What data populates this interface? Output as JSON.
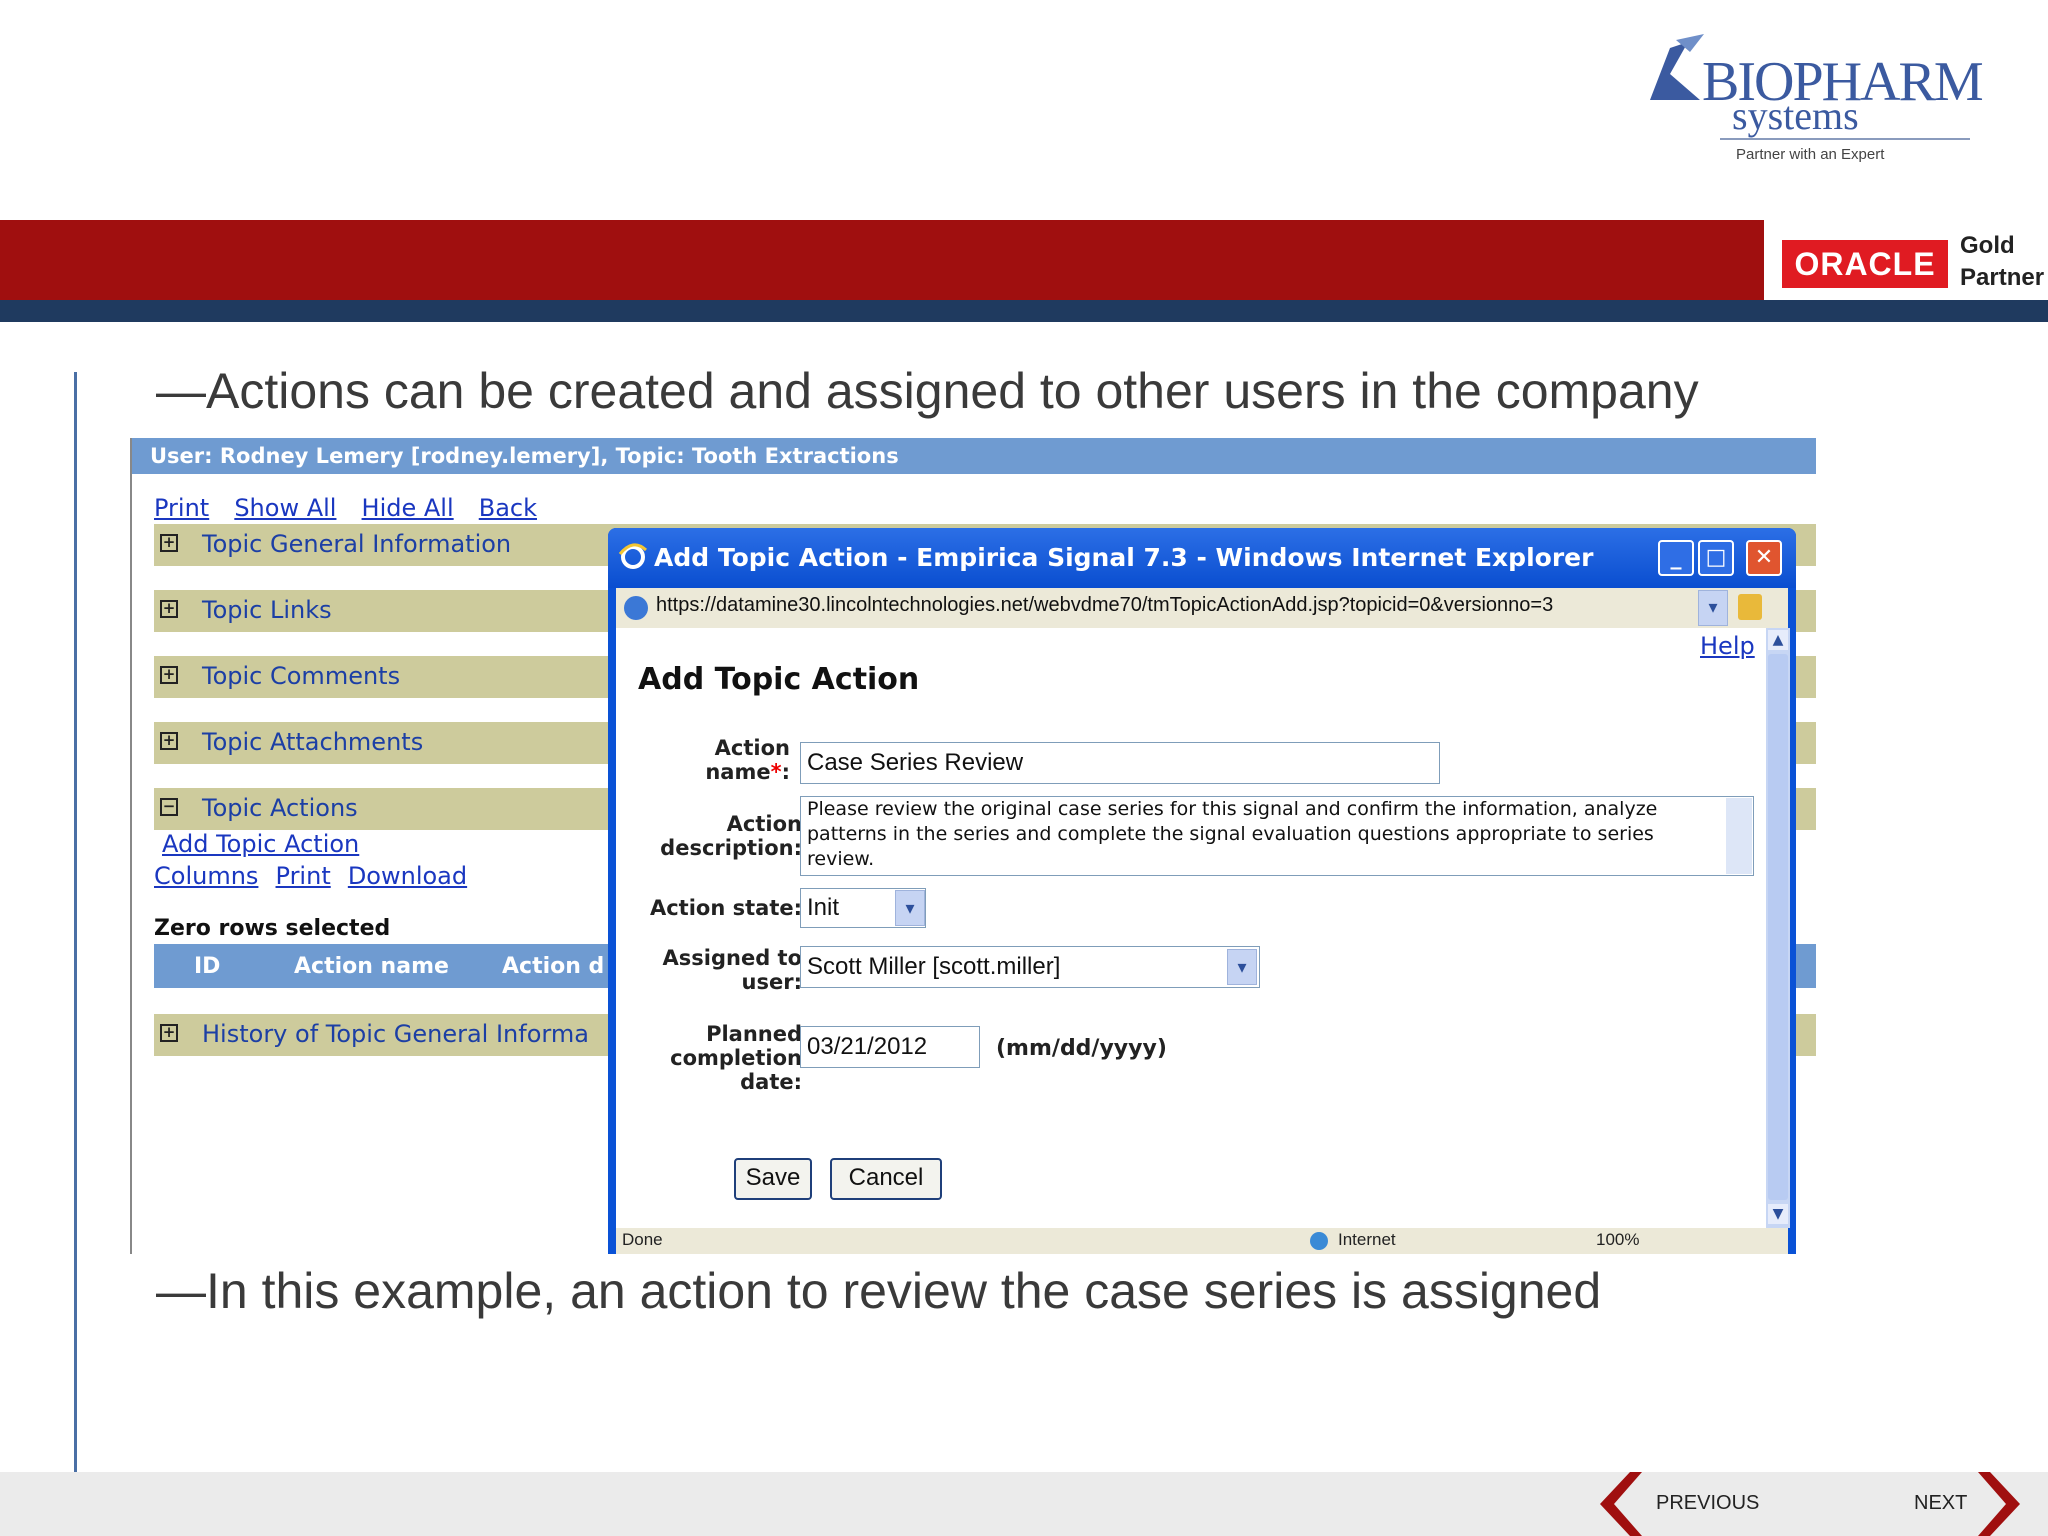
{
  "header": {
    "logo": {
      "name": "BIOPHARM",
      "sub": "systems",
      "tagline": "Partner with an Expert"
    },
    "partner_badge": {
      "brand": "ORACLE",
      "line1": "Gold",
      "line2": "Partner"
    }
  },
  "slide": {
    "bullet1": "—Actions can be created and assigned to other users in the company",
    "bullet2": "—In this example, an action to review the case series is assigned"
  },
  "app": {
    "header_text": "User: Rodney Lemery [rodney.lemery],  Topic: Tooth Extractions",
    "links": [
      "Print",
      "Show All",
      "Hide All",
      "Back"
    ],
    "sections": [
      {
        "label": "Topic General Information",
        "icon": "plus-box-icon"
      },
      {
        "label": "Topic Links",
        "icon": "plus-box-icon"
      },
      {
        "label": "Topic Comments",
        "icon": "plus-box-icon"
      },
      {
        "label": "Topic Attachments",
        "icon": "plus-box-icon"
      },
      {
        "label": "Topic Actions",
        "icon": "minus-box-icon"
      }
    ],
    "add_topic_action_link": "Add Topic Action",
    "sub_links": [
      "Columns",
      "Print",
      "Download"
    ],
    "rows_selected": "Zero rows selected",
    "grid_columns": [
      "ID",
      "Action name",
      "Action d"
    ],
    "history_section": "History of Topic General Informa"
  },
  "dialog": {
    "title": "Add Topic Action - Empirica Signal 7.3 - Windows Internet Explorer",
    "url": "https://datamine30.lincolntechnologies.net/webvdme70/tmTopicActionAdd.jsp?topicid=0&versionno=3",
    "help": "Help",
    "heading": "Add Topic Action",
    "fields": {
      "action_name_label1": "Action",
      "action_name_label2": "name",
      "required_mark": "*",
      "action_name_value": "Case Series Review",
      "desc_label1": "Action",
      "desc_label2": "description:",
      "desc_value": "Please review the original case series for this signal and confirm the information, analyze patterns in the series and complete the signal evaluation questions appropriate to series review.",
      "state_label": "Action state:",
      "state_value": "Init",
      "assigned_label1": "Assigned to",
      "assigned_label2": "user:",
      "assigned_value": "Scott Miller [scott.miller]",
      "planned_label1": "Planned",
      "planned_label2": "completion",
      "planned_label3": "date:",
      "planned_value": "03/21/2012",
      "date_format": "(mm/dd/yyyy)"
    },
    "buttons": {
      "save": "Save",
      "cancel": "Cancel"
    },
    "status": {
      "left": "Done",
      "zone": "Internet",
      "zoom": "100%"
    }
  },
  "footer": {
    "previous": "PREVIOUS",
    "next": "NEXT"
  },
  "colors": {
    "red_band": "#a00f0f",
    "navy_band": "#1f3a5f",
    "oracle_red": "#e01b22",
    "ie_title": "#0a52d6",
    "section_bg": "#cdcb9c",
    "header_blue": "#6f9bd1"
  }
}
